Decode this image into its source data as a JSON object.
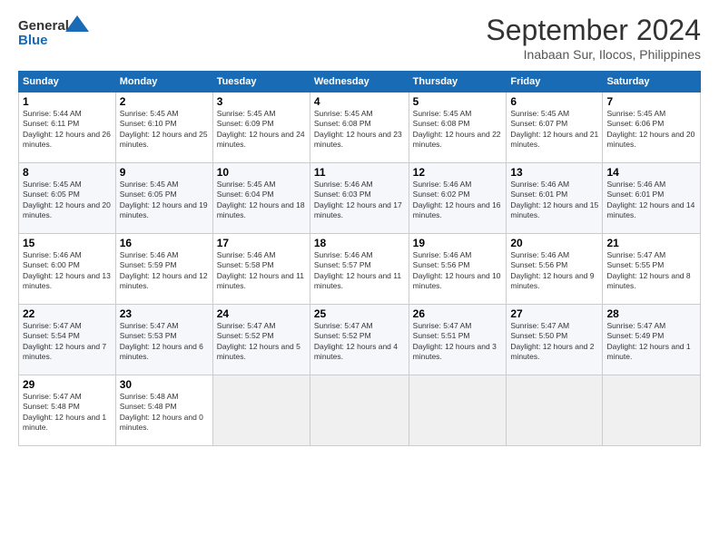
{
  "header": {
    "logo_line1": "General",
    "logo_line2": "Blue",
    "title": "September 2024",
    "subtitle": "Inabaan Sur, Ilocos, Philippines"
  },
  "calendar": {
    "columns": [
      "Sunday",
      "Monday",
      "Tuesday",
      "Wednesday",
      "Thursday",
      "Friday",
      "Saturday"
    ],
    "weeks": [
      [
        null,
        {
          "day": 2,
          "sunrise": "5:45 AM",
          "sunset": "6:10 PM",
          "daylight": "12 hours and 25 minutes."
        },
        {
          "day": 3,
          "sunrise": "5:45 AM",
          "sunset": "6:09 PM",
          "daylight": "12 hours and 24 minutes."
        },
        {
          "day": 4,
          "sunrise": "5:45 AM",
          "sunset": "6:08 PM",
          "daylight": "12 hours and 23 minutes."
        },
        {
          "day": 5,
          "sunrise": "5:45 AM",
          "sunset": "6:08 PM",
          "daylight": "12 hours and 22 minutes."
        },
        {
          "day": 6,
          "sunrise": "5:45 AM",
          "sunset": "6:07 PM",
          "daylight": "12 hours and 21 minutes."
        },
        {
          "day": 7,
          "sunrise": "5:45 AM",
          "sunset": "6:06 PM",
          "daylight": "12 hours and 20 minutes."
        }
      ],
      [
        {
          "day": 1,
          "sunrise": "5:44 AM",
          "sunset": "6:11 PM",
          "daylight": "12 hours and 26 minutes."
        },
        {
          "day": 8,
          "sunrise": "5:45 AM",
          "sunset": "6:05 PM",
          "daylight": "12 hours and 20 minutes."
        },
        null,
        null,
        null,
        null,
        null
      ],
      [
        {
          "day": 8,
          "sunrise": "5:45 AM",
          "sunset": "6:05 PM",
          "daylight": "12 hours and 20 minutes."
        },
        {
          "day": 9,
          "sunrise": "5:45 AM",
          "sunset": "6:05 PM",
          "daylight": "12 hours and 19 minutes."
        },
        {
          "day": 10,
          "sunrise": "5:45 AM",
          "sunset": "6:04 PM",
          "daylight": "12 hours and 18 minutes."
        },
        {
          "day": 11,
          "sunrise": "5:46 AM",
          "sunset": "6:03 PM",
          "daylight": "12 hours and 17 minutes."
        },
        {
          "day": 12,
          "sunrise": "5:46 AM",
          "sunset": "6:02 PM",
          "daylight": "12 hours and 16 minutes."
        },
        {
          "day": 13,
          "sunrise": "5:46 AM",
          "sunset": "6:01 PM",
          "daylight": "12 hours and 15 minutes."
        },
        {
          "day": 14,
          "sunrise": "5:46 AM",
          "sunset": "6:01 PM",
          "daylight": "12 hours and 14 minutes."
        }
      ],
      [
        {
          "day": 15,
          "sunrise": "5:46 AM",
          "sunset": "6:00 PM",
          "daylight": "12 hours and 13 minutes."
        },
        {
          "day": 16,
          "sunrise": "5:46 AM",
          "sunset": "5:59 PM",
          "daylight": "12 hours and 12 minutes."
        },
        {
          "day": 17,
          "sunrise": "5:46 AM",
          "sunset": "5:58 PM",
          "daylight": "12 hours and 11 minutes."
        },
        {
          "day": 18,
          "sunrise": "5:46 AM",
          "sunset": "5:57 PM",
          "daylight": "12 hours and 11 minutes."
        },
        {
          "day": 19,
          "sunrise": "5:46 AM",
          "sunset": "5:56 PM",
          "daylight": "12 hours and 10 minutes."
        },
        {
          "day": 20,
          "sunrise": "5:46 AM",
          "sunset": "5:56 PM",
          "daylight": "12 hours and 9 minutes."
        },
        {
          "day": 21,
          "sunrise": "5:47 AM",
          "sunset": "5:55 PM",
          "daylight": "12 hours and 8 minutes."
        }
      ],
      [
        {
          "day": 22,
          "sunrise": "5:47 AM",
          "sunset": "5:54 PM",
          "daylight": "12 hours and 7 minutes."
        },
        {
          "day": 23,
          "sunrise": "5:47 AM",
          "sunset": "5:53 PM",
          "daylight": "12 hours and 6 minutes."
        },
        {
          "day": 24,
          "sunrise": "5:47 AM",
          "sunset": "5:52 PM",
          "daylight": "12 hours and 5 minutes."
        },
        {
          "day": 25,
          "sunrise": "5:47 AM",
          "sunset": "5:52 PM",
          "daylight": "12 hours and 4 minutes."
        },
        {
          "day": 26,
          "sunrise": "5:47 AM",
          "sunset": "5:51 PM",
          "daylight": "12 hours and 3 minutes."
        },
        {
          "day": 27,
          "sunrise": "5:47 AM",
          "sunset": "5:50 PM",
          "daylight": "12 hours and 2 minutes."
        },
        {
          "day": 28,
          "sunrise": "5:47 AM",
          "sunset": "5:49 PM",
          "daylight": "12 hours and 1 minute."
        }
      ],
      [
        {
          "day": 29,
          "sunrise": "5:47 AM",
          "sunset": "5:48 PM",
          "daylight": "12 hours and 1 minute."
        },
        {
          "day": 30,
          "sunrise": "5:48 AM",
          "sunset": "5:48 PM",
          "daylight": "12 hours and 0 minutes."
        },
        null,
        null,
        null,
        null,
        null
      ]
    ]
  }
}
